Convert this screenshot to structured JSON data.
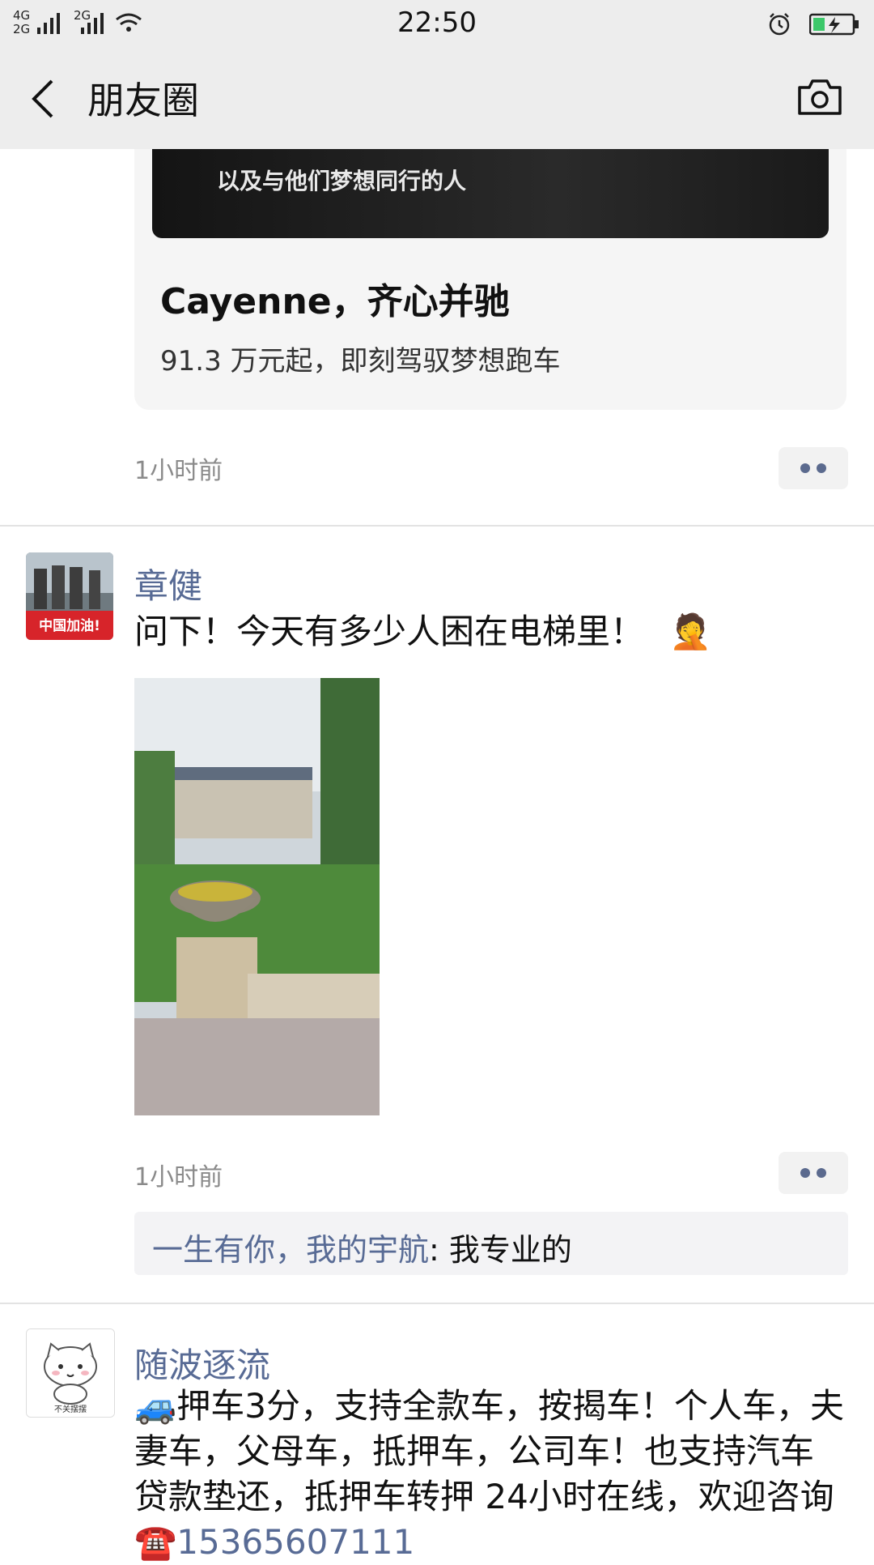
{
  "status_bar": {
    "network_top": "4G",
    "network_bottom": "2G",
    "network2": "2G",
    "time": "22:50"
  },
  "header": {
    "title": "朋友圈"
  },
  "ad": {
    "banner_text": "以及与他们梦想同行的人",
    "title": "Cayenne，齐心并驰",
    "subtitle": "91.3 万元起，即刻驾驭梦想跑车",
    "time": "1小时前"
  },
  "post1": {
    "avatar_badge": "中国加油!",
    "name": "章健",
    "text": "问下！今天有多少人困在电梯里！",
    "emoji": "🤦",
    "time": "1小时前",
    "comment_author": "一生有你，我的宇航",
    "comment_sep": ": ",
    "comment_text": "我专业的"
  },
  "post2": {
    "avatar_caption": "不关摆摆",
    "name": "随波逐流",
    "emoji_car": "🚙",
    "text": "押车3分，支持全款车，按揭车！个人车，夫妻车，父母车，抵押车，公司车！也支持汽车贷款垫还，抵押车转押 24小时在线，欢迎咨询",
    "emoji_phone": "☎️",
    "phone": "15365607111"
  },
  "colors": {
    "link": "#586b95",
    "header_bg": "#ededed"
  }
}
